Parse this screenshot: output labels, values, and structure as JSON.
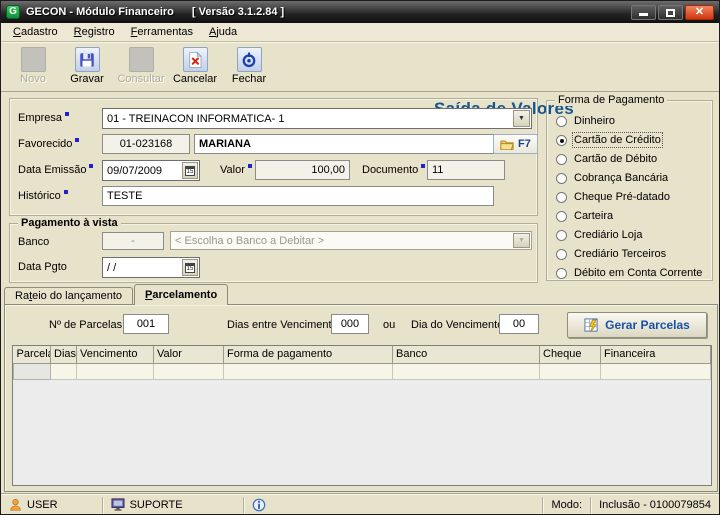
{
  "window": {
    "title_app": "GECON  -  Módulo Financeiro",
    "title_version": "[ Versão 3.1.2.84 ]",
    "icon_letter": "G"
  },
  "menu": {
    "items": [
      "Cadastro",
      "Registro",
      "Ferramentas",
      "Ajuda"
    ]
  },
  "toolbar": {
    "buttons": [
      {
        "label": "Novo",
        "icon": "new-icon",
        "disabled": true
      },
      {
        "label": "Gravar",
        "icon": "save-icon",
        "disabled": false
      },
      {
        "label": "Consultar",
        "icon": "search-icon",
        "disabled": true
      },
      {
        "label": "Cancelar",
        "icon": "cancel-icon",
        "disabled": false
      },
      {
        "label": "Fechar",
        "icon": "power-close-icon",
        "disabled": false
      }
    ],
    "page_title": "Saída de Valores"
  },
  "form": {
    "empresa_label": "Empresa",
    "empresa_value": "01 - TREINACON INFORMATICA- 1",
    "favorecido_label": "Favorecido",
    "favorecido_code": "01-023168",
    "favorecido_name": "MARIANA",
    "f7_label": "F7",
    "data_emissao_label": "Data Emissão",
    "data_emissao_value": "09/07/2009",
    "valor_label": "Valor",
    "valor_value": "100,00",
    "documento_label": "Documento",
    "documento_value": "11",
    "historico_label": "Histórico",
    "historico_value": "TESTE"
  },
  "pagamento_vista": {
    "title": "Pagamento à vista",
    "banco_label": "Banco",
    "banco_code": "-",
    "banco_placeholder": "< Escolha o Banco a Debitar >",
    "data_pgto_label": "Data Pgto",
    "data_pgto_value": "/ /"
  },
  "forma_pagamento": {
    "title": "Forma de Pagamento",
    "options": [
      "Dinheiro",
      "Cartão de Crédito",
      "Cartão de Débito",
      "Cobrança Bancária",
      "Cheque Pré-datado",
      "Carteira",
      "Crediário Loja",
      "Crediário Terceiros",
      "Débito em Conta Corrente"
    ],
    "selected": "Cartão de Crédito"
  },
  "tabs": {
    "items": [
      "Rateio do lançamento",
      "Parcelamento"
    ],
    "active": "Parcelamento"
  },
  "parcelamento": {
    "num_parcelas_label": "Nº de Parcelas",
    "num_parcelas_value": "001",
    "dias_entre_label": "Dias entre Vencimentos",
    "dias_entre_value": "000",
    "ou_label": "ou",
    "dia_venc_label": "Dia do Vencimento",
    "dia_venc_value": "00",
    "gerar_button_label": "Gerar Parcelas",
    "grid_headers": [
      "Parcela",
      "Dias",
      "Vencimento",
      "Valor",
      "Forma de pagamento",
      "Banco",
      "Cheque",
      "Financeira"
    ]
  },
  "statusbar": {
    "user": "USER",
    "suporte": "SUPORTE",
    "modo_label": "Modo:",
    "modo_value": "Inclusão - 0100079854"
  },
  "colors": {
    "accent_blue": "#15568c",
    "client_beige": "#e7e2ca",
    "close_button_red": "#d0350f",
    "required_marker_blue": "#2222cc"
  }
}
